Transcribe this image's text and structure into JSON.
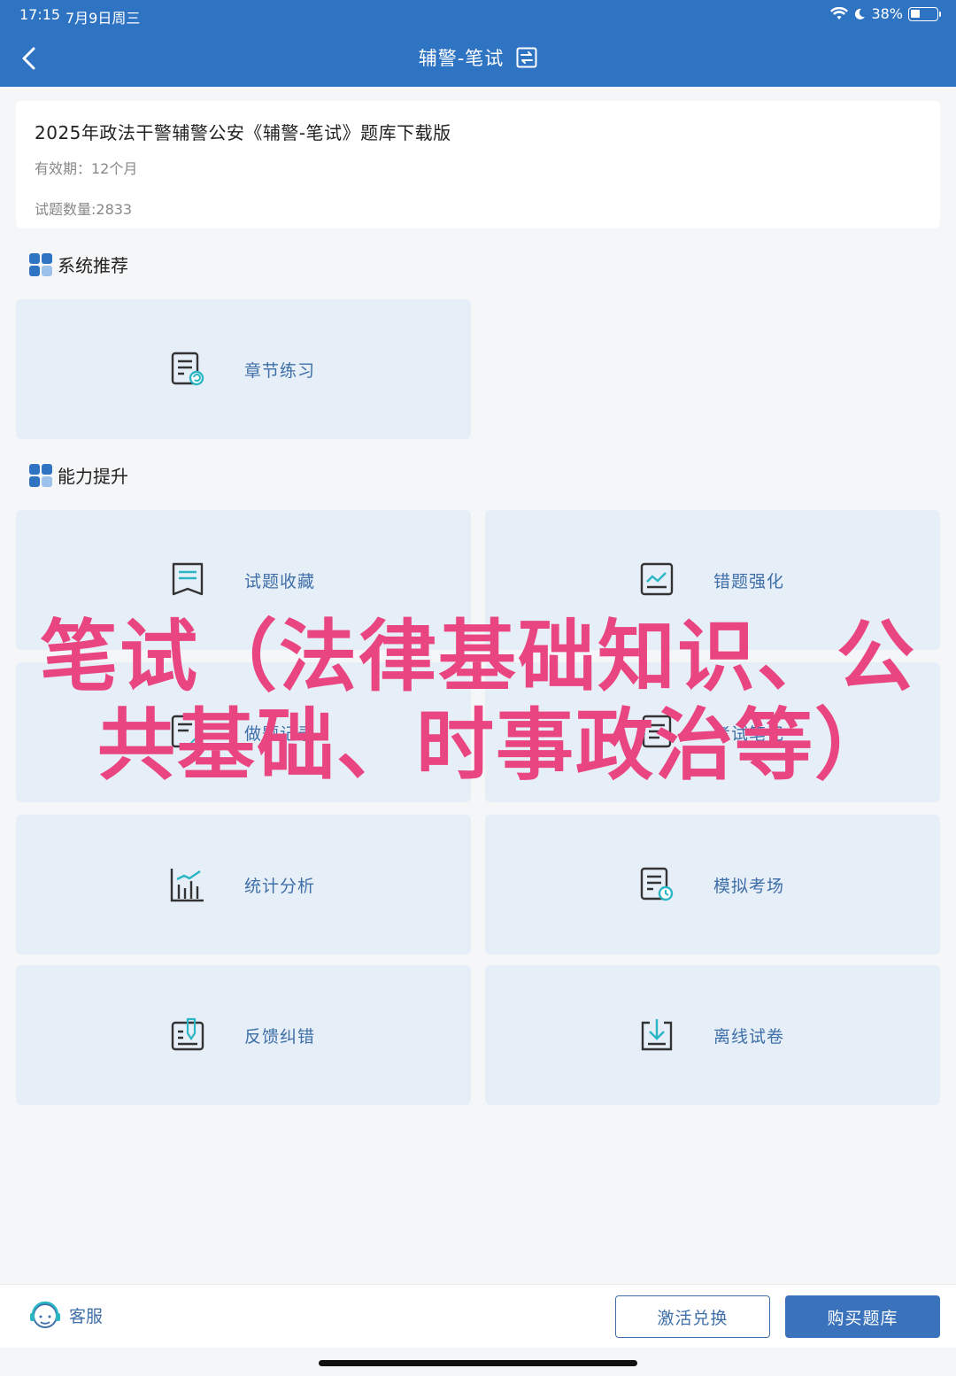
{
  "status_bar": {
    "time": "17:15",
    "date": "7月9日周三",
    "battery": "38%",
    "battery_level": 0.38
  },
  "nav": {
    "title": "辅警-笔试"
  },
  "info_card": {
    "name": "2025年政法干警辅警公安《辅警-笔试》题库下载版",
    "validity": "有效期：12个月",
    "question_count": "试题数量:2833"
  },
  "sections": {
    "recommend": {
      "label": "系统推荐"
    },
    "ability": {
      "label": "能力提升"
    }
  },
  "tiles": {
    "chapter_practice": "章节练习",
    "favorites": "试题收藏",
    "error_boost": "错题强化",
    "practice_record": "做题记录",
    "exam_notes": "考试笔记",
    "statistics": "统计分析",
    "mock_exam": "模拟考场",
    "feedback": "反馈纠错",
    "offline_paper": "离线试卷"
  },
  "overlay": {
    "line1": "笔试（法律基础知识、公",
    "line2": "共基础、时事政治等）"
  },
  "bottom": {
    "customer_service": "客服",
    "activate_button": "激活兑换",
    "buy_button": "购买题库"
  },
  "colors": {
    "accent": "#2f73c3",
    "tile_bg": "#e6eef7",
    "tile_text": "#3f6fa8",
    "overlay_text": "#e94580"
  }
}
